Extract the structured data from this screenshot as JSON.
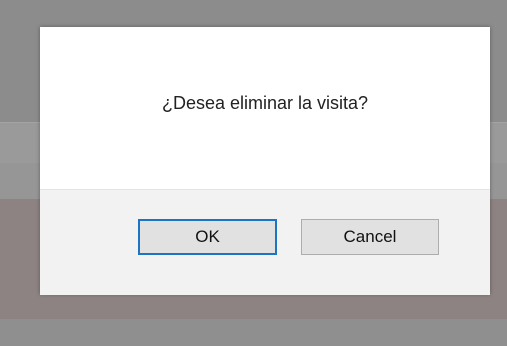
{
  "dialog": {
    "message": "¿Desea eliminar la visita?",
    "ok_label": "OK",
    "cancel_label": "Cancel"
  },
  "colors": {
    "overlay": "#8f8f8f",
    "dialog_body": "#ffffff",
    "dialog_footer": "#f2f2f2",
    "focused_button_border": "#1e74c4",
    "button_bg": "#e1e1e1"
  }
}
